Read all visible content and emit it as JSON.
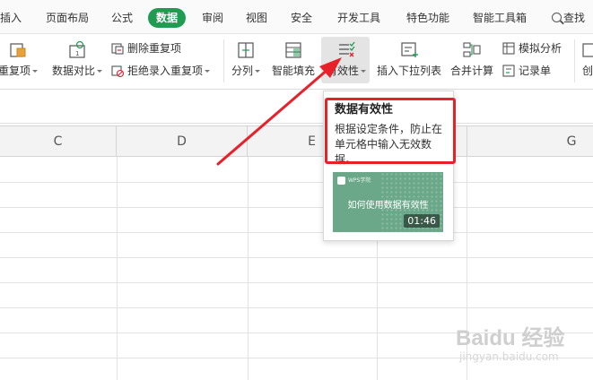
{
  "tabs": [
    {
      "label": "插入",
      "active": false
    },
    {
      "label": "页面布局",
      "active": false
    },
    {
      "label": "公式",
      "active": false
    },
    {
      "label": "数据",
      "active": true
    },
    {
      "label": "审阅",
      "active": false
    },
    {
      "label": "视图",
      "active": false
    },
    {
      "label": "安全",
      "active": false
    },
    {
      "label": "开发工具",
      "active": false
    },
    {
      "label": "特色功能",
      "active": false
    },
    {
      "label": "智能工具箱",
      "active": false
    }
  ],
  "search_label": "查找",
  "ribbon": {
    "dedupe_partial": "重复项",
    "compare": "数据对比",
    "delete_duplicates": "删除重复项",
    "reject_duplicates": "拒绝录入重复项",
    "split": "分列",
    "smart_fill": "智能填充",
    "validity": "有效性",
    "insert_dropdown": "插入下拉列表",
    "merge_calc": "合并计算",
    "simulate": "模拟分析",
    "record": "记录单",
    "create_partial": "创"
  },
  "columns": [
    "C",
    "D",
    "E",
    "G"
  ],
  "tooltip": {
    "title": "数据有效性",
    "description": "根据设定条件，防止在单元格中输入无效数据。",
    "video_brand": "WPS学院",
    "video_title": "如何使用数据有效性",
    "video_duration": "01:46"
  },
  "watermark": {
    "main": "Baidu 经验",
    "url": "jingyan.baidu.com"
  },
  "colors": {
    "active_tab": "#1f9c52",
    "highlight_red": "#e8202a",
    "video_bg": "#6aa889"
  }
}
